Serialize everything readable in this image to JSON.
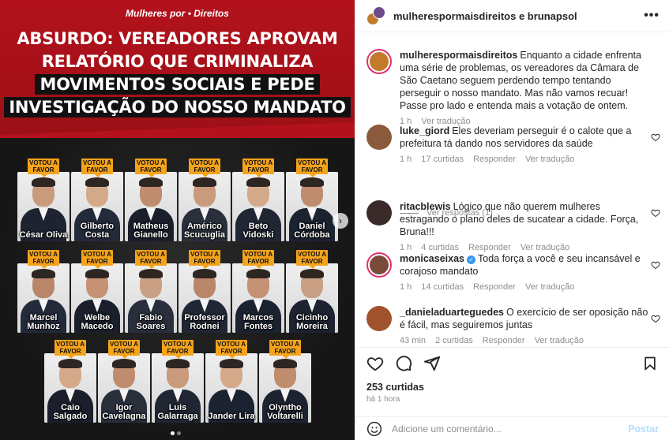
{
  "post_image": {
    "brand": "Mulheres por • Direitos",
    "headline": [
      {
        "text": "ABSURDO: VEREADORES APROVAM",
        "style": "plain"
      },
      {
        "text": "RELATÓRIO QUE CRIMINALIZA",
        "style": "plain"
      },
      {
        "text": "MOVIMENTOS SOCIAIS E PEDE",
        "style": "black"
      },
      {
        "text": "INVESTIGAÇÃO DO NOSSO MANDATO",
        "style": "black"
      }
    ],
    "badge_text": "VOTOU A FAVOR",
    "councilors_row1": [
      "César Oliva",
      "Gilberto Costa",
      "Matheus Gianello",
      "Américo Scucuglia",
      "Beto Vidoski",
      "Daniel Córdoba"
    ],
    "councilors_row2": [
      "Marcel Munhoz",
      "Welbe Macedo",
      "Fabio Soares",
      "Professor Rodnei",
      "Marcos Fontes",
      "Cicinho Moreira"
    ],
    "councilors_row3": [
      "Caio Salgado",
      "Igor Cavelagna",
      "Luis Galarraga",
      "Jander Lira",
      "Olyntho Voltarelli"
    ],
    "carousel_next": "›"
  },
  "header": {
    "title": "mulherespormaisdireitos e brunapsol",
    "more": "•••"
  },
  "comments": [
    {
      "user": "mulherespormaisdireitos",
      "text": "Enquanto a cidade enfrenta uma série de problemas, os vereadores da Câmara de São Caetano seguem perdendo tempo tentando perseguir o nosso mandato. Mas não vamos recuar! Passe pro lado e entenda mais a votação de ontem.",
      "time": "1 h",
      "likes": "",
      "reply": "",
      "translate": "Ver tradução",
      "avatar_color": "#c47a2c"
    },
    {
      "user": "luke_giord",
      "text": "Eles deveriam perseguir é o calote que a prefeitura tá dando nos servidores da saúde",
      "time": "1 h",
      "likes": "17 curtidas",
      "reply": "Responder",
      "translate": "Ver tradução",
      "avatar_color": "#8b5a3c"
    },
    {
      "user": "ritacblewis",
      "text": "Lógico que não querem mulheres estragando o plano deles de sucatear a cidade. Força, Bruna!!!",
      "time": "1 h",
      "likes": "4 curtidas",
      "reply": "Responder",
      "translate": "Ver tradução",
      "avatar_color": "#3b2a2a"
    },
    {
      "user": "monicaseixas",
      "text": "Toda força a você e seu incansável e corajoso mandato",
      "time": "1 h",
      "likes": "14 curtidas",
      "reply": "Responder",
      "translate": "Ver tradução",
      "avatar_color": "#7a4a3a"
    },
    {
      "user": "_danieladuarteguedes",
      "text": "O exercício de ser oposição não é fácil, mas seguiremos juntas",
      "time": "43 min",
      "likes": "2 curtidas",
      "reply": "Responder",
      "translate": "Ver tradução",
      "avatar_color": "#a0522d"
    }
  ],
  "view_replies": "Ver respostas (1)",
  "likes_count": "253 curtidas",
  "posted_time": "há 1 hora",
  "add_comment": {
    "placeholder": "Adicione um comentário...",
    "post_label": "Postar"
  },
  "colors": {
    "poster_red": "#b3121c",
    "badge_orange": "#f4a31b",
    "link_blue_disabled": "#b2dffc",
    "verified_blue": "#3897f0"
  }
}
